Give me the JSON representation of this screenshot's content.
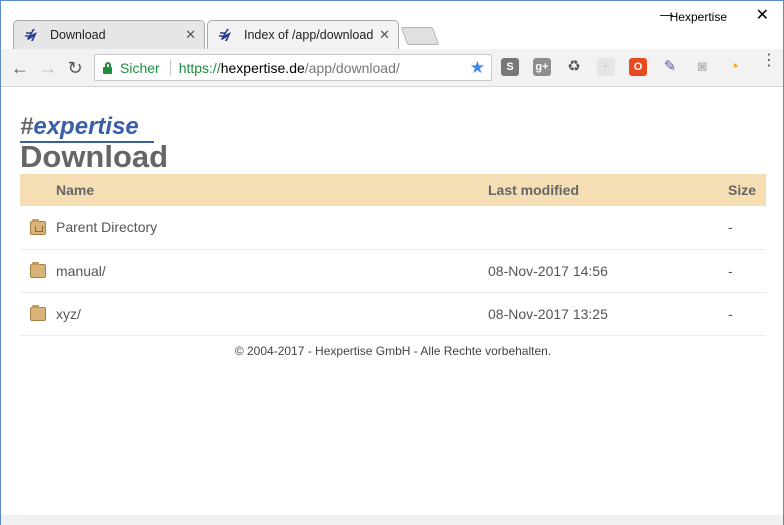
{
  "window": {
    "title": "Hexpertise",
    "minimize_label": "—",
    "close_label": "✕"
  },
  "tabs": [
    {
      "label": "Download",
      "close": "✕",
      "active": false
    },
    {
      "label": "Index of /app/download",
      "close": "✕",
      "active": true
    }
  ],
  "toolbar": {
    "back": "←",
    "forward": "→",
    "reload": "↻",
    "secure_label": "Sicher",
    "url_scheme": "https://",
    "url_host": "hexpertise.de",
    "url_path": "/app/download/",
    "bookmark_star": "★",
    "extensions": [
      {
        "icon": "s-extension-icon",
        "glyph": "S",
        "color": "#777777"
      },
      {
        "icon": "google-plus-extension-icon",
        "glyph": "g+",
        "color": "#8e8e8e"
      },
      {
        "icon": "recycle-extension-icon",
        "glyph": "♻",
        "color": "#555555"
      },
      {
        "icon": "blocked-extension-icon",
        "glyph": "·",
        "color": "#cccccc"
      },
      {
        "icon": "office-extension-icon",
        "glyph": "O",
        "color": "#e8491e"
      },
      {
        "icon": "eyedropper-extension-icon",
        "glyph": "✎",
        "color": "#5a5a9a"
      },
      {
        "icon": "camera-extension-icon",
        "glyph": "◙",
        "color": "#bbbbbb"
      },
      {
        "icon": "speed-dial-extension-icon",
        "glyph": "◔",
        "color": "#f5a623"
      }
    ],
    "menu": "⋮"
  },
  "page": {
    "logo_hash": "#",
    "logo_text": "expertise",
    "heading": "Download",
    "table": {
      "headers": {
        "name": "Name",
        "modified": "Last modified",
        "size": "Size"
      },
      "rows": [
        {
          "name": "Parent Directory",
          "modified": "",
          "size": "-",
          "parent": true
        },
        {
          "name": "manual/",
          "modified": "08-Nov-2017 14:56",
          "size": "-",
          "parent": false
        },
        {
          "name": "xyz/",
          "modified": "08-Nov-2017 13:25",
          "size": "-",
          "parent": false
        }
      ]
    },
    "footer": "© 2004-2017 - Hexpertise GmbH - Alle Rechte vorbehalten."
  },
  "colors": {
    "table_header_bg": "#f5deb3",
    "logo_blue": "#3a5ea8",
    "secure_green": "#1e8e3e",
    "window_border": "#5b8cc9"
  }
}
